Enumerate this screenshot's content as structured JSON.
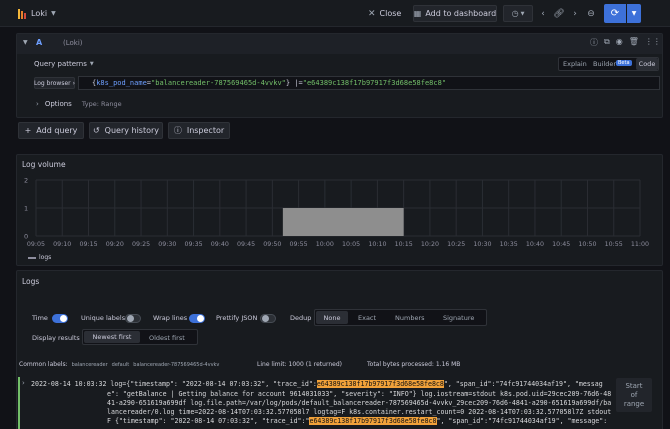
{
  "topbar": {
    "datasource": "Loki",
    "close_label": "Close",
    "add_dashboard_label": "Add to dashboard"
  },
  "query": {
    "letter": "A",
    "datasource_hint": "(Loki)",
    "patterns_label": "Query patterns",
    "mode_explain": "Explain",
    "mode_builder": "Builder",
    "beta_badge": "Beta",
    "mode_code": "Code",
    "browser_label": "Log browser",
    "expr_open": "{",
    "expr_key": "k8s_pod_name",
    "expr_eq": "=",
    "expr_val": "\"balancereader-787569465d-4vvkv\"",
    "expr_close": "}",
    "expr_op": " |=",
    "expr_filter": "\"e64389c138f17b97917f3d68e58fe8c8\"",
    "options_label": "Options",
    "options_type": "Type: Range"
  },
  "actions": {
    "add_query": "Add query",
    "query_history": "Query history",
    "inspector": "Inspector"
  },
  "volume": {
    "title": "Log volume",
    "legend": "logs"
  },
  "chart_data": {
    "type": "bar",
    "title": "Log volume",
    "y_ticks": [
      "2",
      "1",
      "0"
    ],
    "ylim": [
      0,
      2
    ],
    "x_ticks": [
      "09:05",
      "09:10",
      "09:15",
      "09:20",
      "09:25",
      "09:30",
      "09:35",
      "09:40",
      "09:45",
      "09:50",
      "09:55",
      "10:00",
      "10:05",
      "10:10",
      "10:15",
      "10:20",
      "10:25",
      "10:30",
      "10:35",
      "10:40",
      "10:45",
      "10:50",
      "10:55",
      "11:00"
    ],
    "series": [
      {
        "name": "logs",
        "bars": [
          {
            "start": "09:52",
            "end": "10:15",
            "value": 1
          }
        ]
      }
    ],
    "legend_position": "bottom-left",
    "grid": true
  },
  "logs": {
    "title": "Logs",
    "time_label": "Time",
    "unique_labels_label": "Unique labels",
    "wrap_lines_label": "Wrap lines",
    "prettify_label": "Prettify JSON",
    "dedup_label": "Dedup",
    "dedup_options": [
      "None",
      "Exact",
      "Numbers",
      "Signature"
    ],
    "display_label": "Display results",
    "newest_first": "Newest first",
    "oldest_first": "Oldest first",
    "common_labels_label": "Common labels:",
    "common_label_1": "balancereader",
    "common_label_2": "default",
    "common_label_3": "balancereader-787569465d-4vvkv",
    "line_limit": "Line limit: 1000 (1 returned)",
    "bytes_processed": "Total bytes processed: 1.16 MB",
    "start_of_range": [
      "Start",
      "of",
      "range"
    ],
    "entry": {
      "l1_a": "2022-08-14 10:03:32 log={\"timestamp\": \"2022-08-14 07:03:32\", \"trace_id\":",
      "l1_hl": "e64389c138f17b97917f3d68e58fe8c8",
      "l1_b": "\", \"span_id\":\"74fc91744034af19\", \"messag",
      "l2": "e\": \"getBalance | Getting balance for account 9614031033\", \"severity\": \"INFO\"} log.iostream=stdout k8s.pod.uid=29cec209-76d6-48",
      "l3": "41-a290-651619a699df log.file.path=/var/log/pods/default_balancereader-787569465d-4vvkv_29cec209-76d6-4841-a290-651619a699df/ba",
      "l4": "lancereader/0.log time=2022-08-14T07:03:32.577058l7 logtag=F k8s.container.restart_count=0 2022-08-14T07:03:32.577058l7Z stdout",
      "l5_a": "F {\"timestamp\": \"2022-08-14 07:03:32\", \"trace_id\":\"",
      "l5_hl": "e64389c138f17b97917f3d68e58fe8c8",
      "l5_b": "\", \"span_id\":\"74fc91744034af19\", \"message\":"
    }
  }
}
